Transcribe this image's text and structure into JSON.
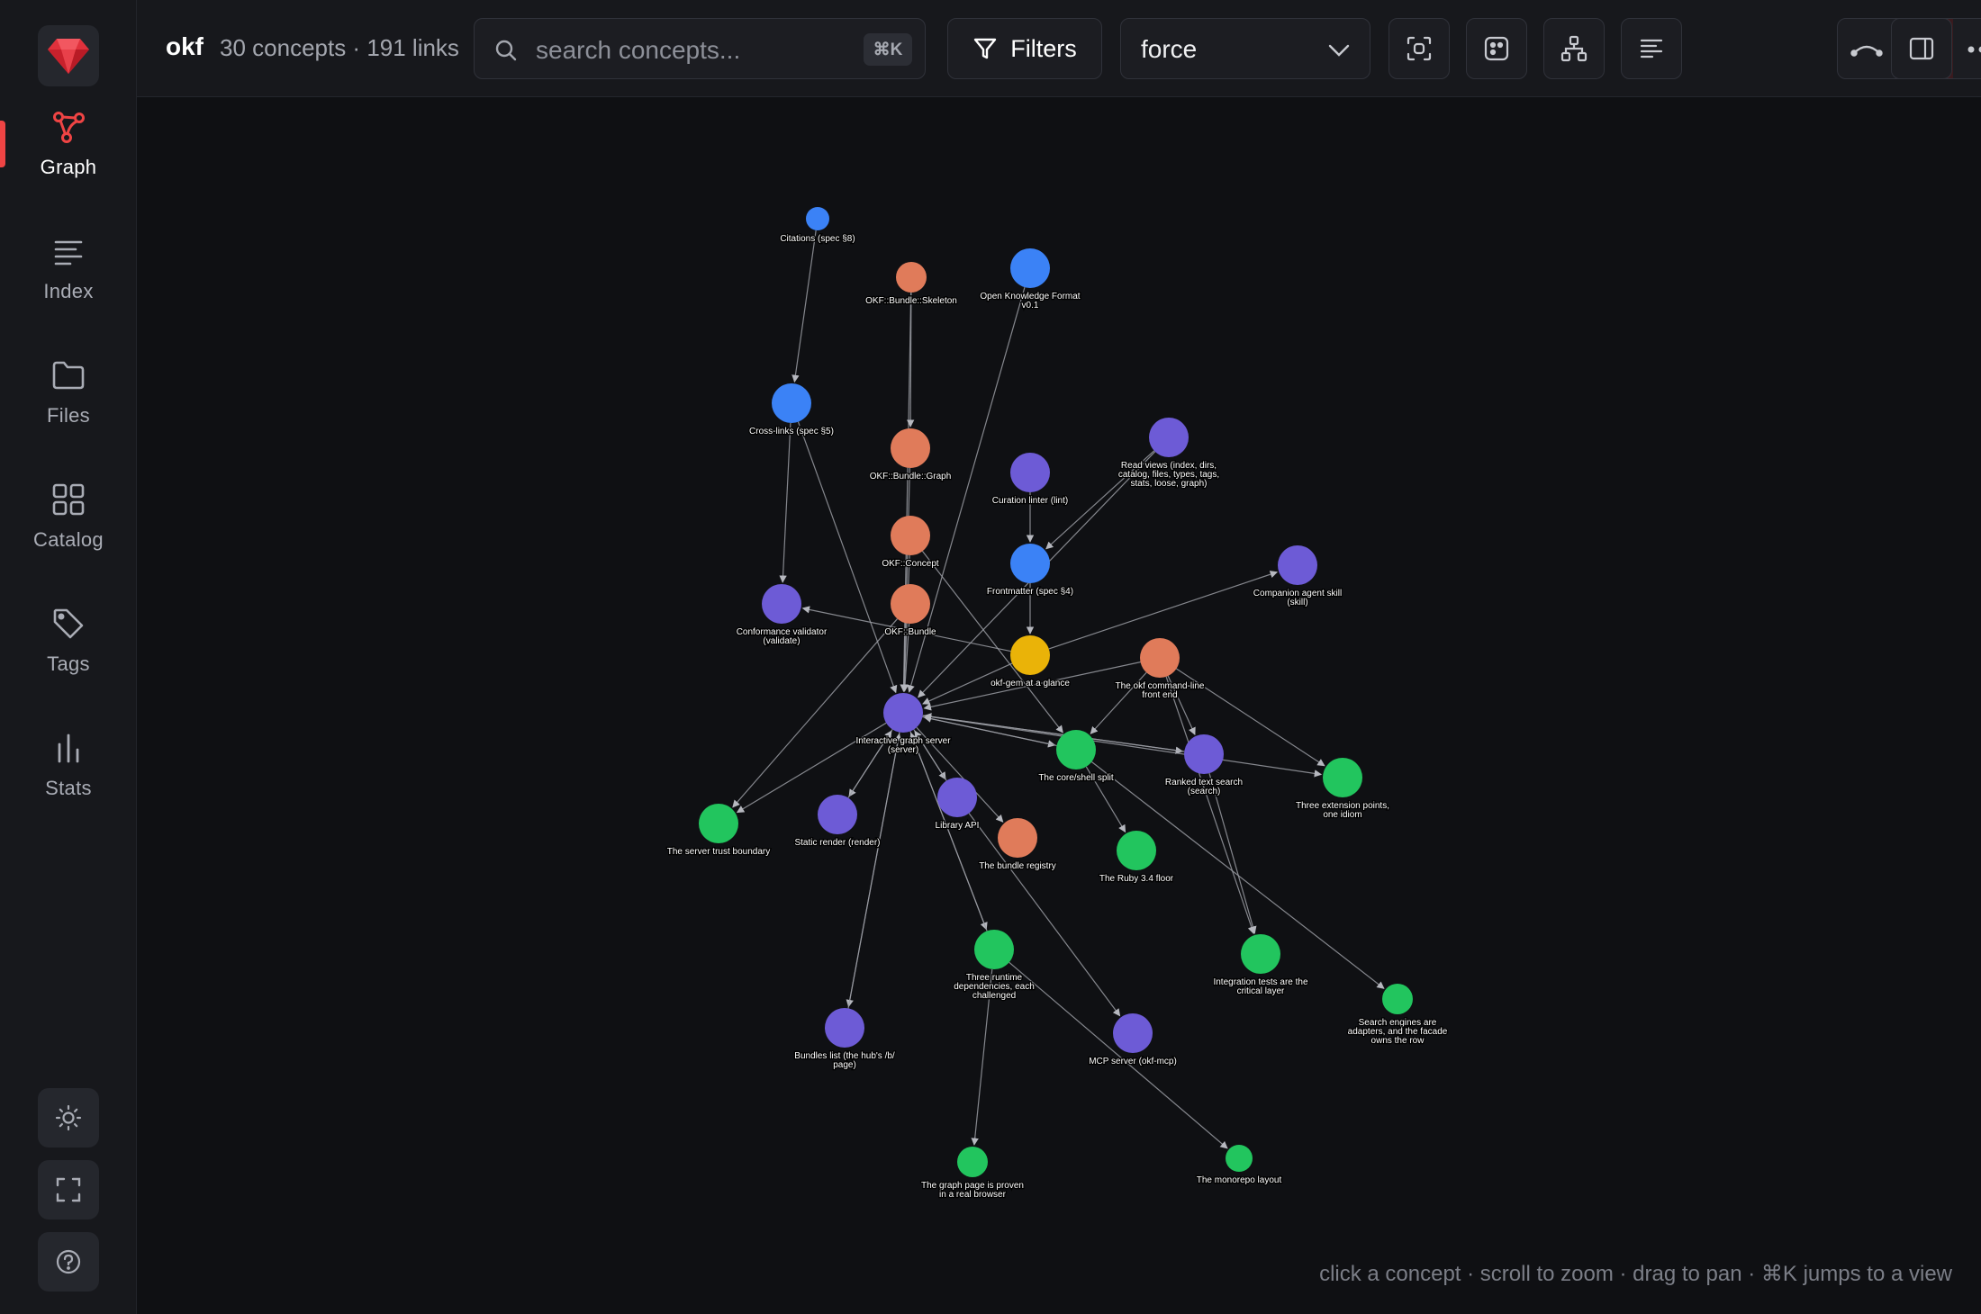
{
  "app": {
    "name": "okf",
    "stats": "30 concepts · 191 links"
  },
  "sidebar": {
    "logo_icon": "ruby-gem-icon",
    "items": [
      {
        "label": "Graph",
        "icon": "graph-icon",
        "active": true
      },
      {
        "label": "Index",
        "icon": "list-icon"
      },
      {
        "label": "Files",
        "icon": "folder-icon"
      },
      {
        "label": "Catalog",
        "icon": "grid-icon"
      },
      {
        "label": "Tags",
        "icon": "tag-icon"
      },
      {
        "label": "Stats",
        "icon": "bar-chart-icon"
      }
    ],
    "bottom": [
      "sun-icon",
      "fullscreen-icon",
      "help-icon"
    ]
  },
  "toolbar": {
    "search_placeholder": "search concepts...",
    "search_shortcut": "⌘K",
    "filters_label": "Filters",
    "layout_value": "force",
    "buttons": [
      "focus-icon",
      "random-icon",
      "hierarchy-icon",
      "align-icon",
      "curved-edges-icon",
      "straight-edges-icon",
      "more-icon",
      "side-panel-icon"
    ]
  },
  "graph": {
    "colors": {
      "blue": "#3b82f6",
      "orange": "#e07b5a",
      "purple": "#6d5bd6",
      "green": "#22c55e",
      "yellow": "#eab308",
      "edge": "#9a9ca3",
      "accent": "#ef4444"
    },
    "nodes": [
      {
        "id": "citations",
        "label": [
          "Citations (spec §8)"
        ],
        "color": "blue"
      },
      {
        "id": "skeleton",
        "label": [
          "OKF::Bundle::Skeleton"
        ],
        "color": "orange"
      },
      {
        "id": "okf",
        "label": [
          "Open Knowledge Format",
          "v0.1"
        ],
        "color": "blue"
      },
      {
        "id": "crosslinks",
        "label": [
          "Cross-links (spec §5)"
        ],
        "color": "blue"
      },
      {
        "id": "bgraph",
        "label": [
          "OKF::Bundle::Graph"
        ],
        "color": "orange"
      },
      {
        "id": "readviews",
        "label": [
          "Read views (index, dirs,",
          "catalog, files, types, tags,",
          "stats, loose, graph)"
        ],
        "color": "purple"
      },
      {
        "id": "lint",
        "label": [
          "Curation linter (lint)"
        ],
        "color": "purple"
      },
      {
        "id": "concept",
        "label": [
          "OKF::Concept"
        ],
        "color": "orange"
      },
      {
        "id": "frontmatter",
        "label": [
          "Frontmatter (spec §4)"
        ],
        "color": "blue"
      },
      {
        "id": "skill",
        "label": [
          "Companion agent skill",
          "(skill)"
        ],
        "color": "purple"
      },
      {
        "id": "validator",
        "label": [
          "Conformance validator",
          "(validate)"
        ],
        "color": "purple"
      },
      {
        "id": "bundle",
        "label": [
          "OKF::Bundle"
        ],
        "color": "orange"
      },
      {
        "id": "glance",
        "label": [
          "okf-gem at a glance"
        ],
        "color": "yellow"
      },
      {
        "id": "cli",
        "label": [
          "The okf command-line",
          "front end"
        ],
        "color": "orange"
      },
      {
        "id": "server",
        "label": [
          "Interactive graph server",
          "(server)"
        ],
        "color": "purple"
      },
      {
        "id": "coreshell",
        "label": [
          "The core/shell split"
        ],
        "color": "green"
      },
      {
        "id": "ranked",
        "label": [
          "Ranked text search",
          "(search)"
        ],
        "color": "purple"
      },
      {
        "id": "extpoints",
        "label": [
          "Three extension points,",
          "one idiom"
        ],
        "color": "green"
      },
      {
        "id": "trust",
        "label": [
          "The server trust boundary"
        ],
        "color": "green"
      },
      {
        "id": "render",
        "label": [
          "Static render (render)"
        ],
        "color": "purple"
      },
      {
        "id": "libapi",
        "label": [
          "Library API"
        ],
        "color": "purple"
      },
      {
        "id": "registry",
        "label": [
          "The bundle registry"
        ],
        "color": "orange"
      },
      {
        "id": "ruby",
        "label": [
          "The Ruby 3.4 floor"
        ],
        "color": "green"
      },
      {
        "id": "runtime",
        "label": [
          "Three runtime",
          "dependencies, each",
          "challenged"
        ],
        "color": "green"
      },
      {
        "id": "integration",
        "label": [
          "Integration tests are the",
          "critical layer"
        ],
        "color": "green"
      },
      {
        "id": "engines",
        "label": [
          "Search engines are",
          "adapters, and the facade",
          "owns the row"
        ],
        "color": "green"
      },
      {
        "id": "bundles",
        "label": [
          "Bundles list (the hub's /b/",
          "page)"
        ],
        "color": "purple"
      },
      {
        "id": "mcp",
        "label": [
          "MCP server (okf-mcp)"
        ],
        "color": "purple"
      },
      {
        "id": "graphpage",
        "label": [
          "The graph page is proven",
          "in a real browser"
        ],
        "color": "green"
      },
      {
        "id": "monorepo",
        "label": [
          "The monorepo layout"
        ],
        "color": "green"
      }
    ],
    "edges": [
      [
        "citations",
        "crosslinks"
      ],
      [
        "crosslinks",
        "validator"
      ],
      [
        "crosslinks",
        "server"
      ],
      [
        "skeleton",
        "server"
      ],
      [
        "skeleton",
        "bgraph"
      ],
      [
        "okf",
        "server"
      ],
      [
        "bgraph",
        "server"
      ],
      [
        "concept",
        "server"
      ],
      [
        "bundle",
        "server"
      ],
      [
        "lint",
        "frontmatter"
      ],
      [
        "readviews",
        "frontmatter"
      ],
      [
        "readviews",
        "server"
      ],
      [
        "glance",
        "skill"
      ],
      [
        "glance",
        "server"
      ],
      [
        "glance",
        "validator"
      ],
      [
        "frontmatter",
        "glance"
      ],
      [
        "cli",
        "server"
      ],
      [
        "cli",
        "coreshell"
      ],
      [
        "cli",
        "ranked"
      ],
      [
        "cli",
        "extpoints"
      ],
      [
        "cli",
        "integration"
      ],
      [
        "server",
        "coreshell"
      ],
      [
        "server",
        "ranked"
      ],
      [
        "server",
        "extpoints"
      ],
      [
        "server",
        "trust"
      ],
      [
        "server",
        "render"
      ],
      [
        "server",
        "libapi"
      ],
      [
        "server",
        "registry"
      ],
      [
        "server",
        "runtime"
      ],
      [
        "server",
        "bundles"
      ],
      [
        "concept",
        "coreshell"
      ],
      [
        "coreshell",
        "ruby"
      ],
      [
        "coreshell",
        "engines"
      ],
      [
        "ranked",
        "integration"
      ],
      [
        "libapi",
        "mcp"
      ],
      [
        "runtime",
        "graphpage"
      ],
      [
        "runtime",
        "monorepo"
      ],
      [
        "bundle",
        "trust"
      ],
      [
        "libapi",
        "server"
      ],
      [
        "render",
        "server"
      ],
      [
        "coreshell",
        "server"
      ],
      [
        "ranked",
        "server"
      ],
      [
        "bundles",
        "server"
      ],
      [
        "runtime",
        "server"
      ]
    ]
  },
  "hint": "click a concept · scroll to zoom · drag to pan · ⌘K jumps to a view"
}
